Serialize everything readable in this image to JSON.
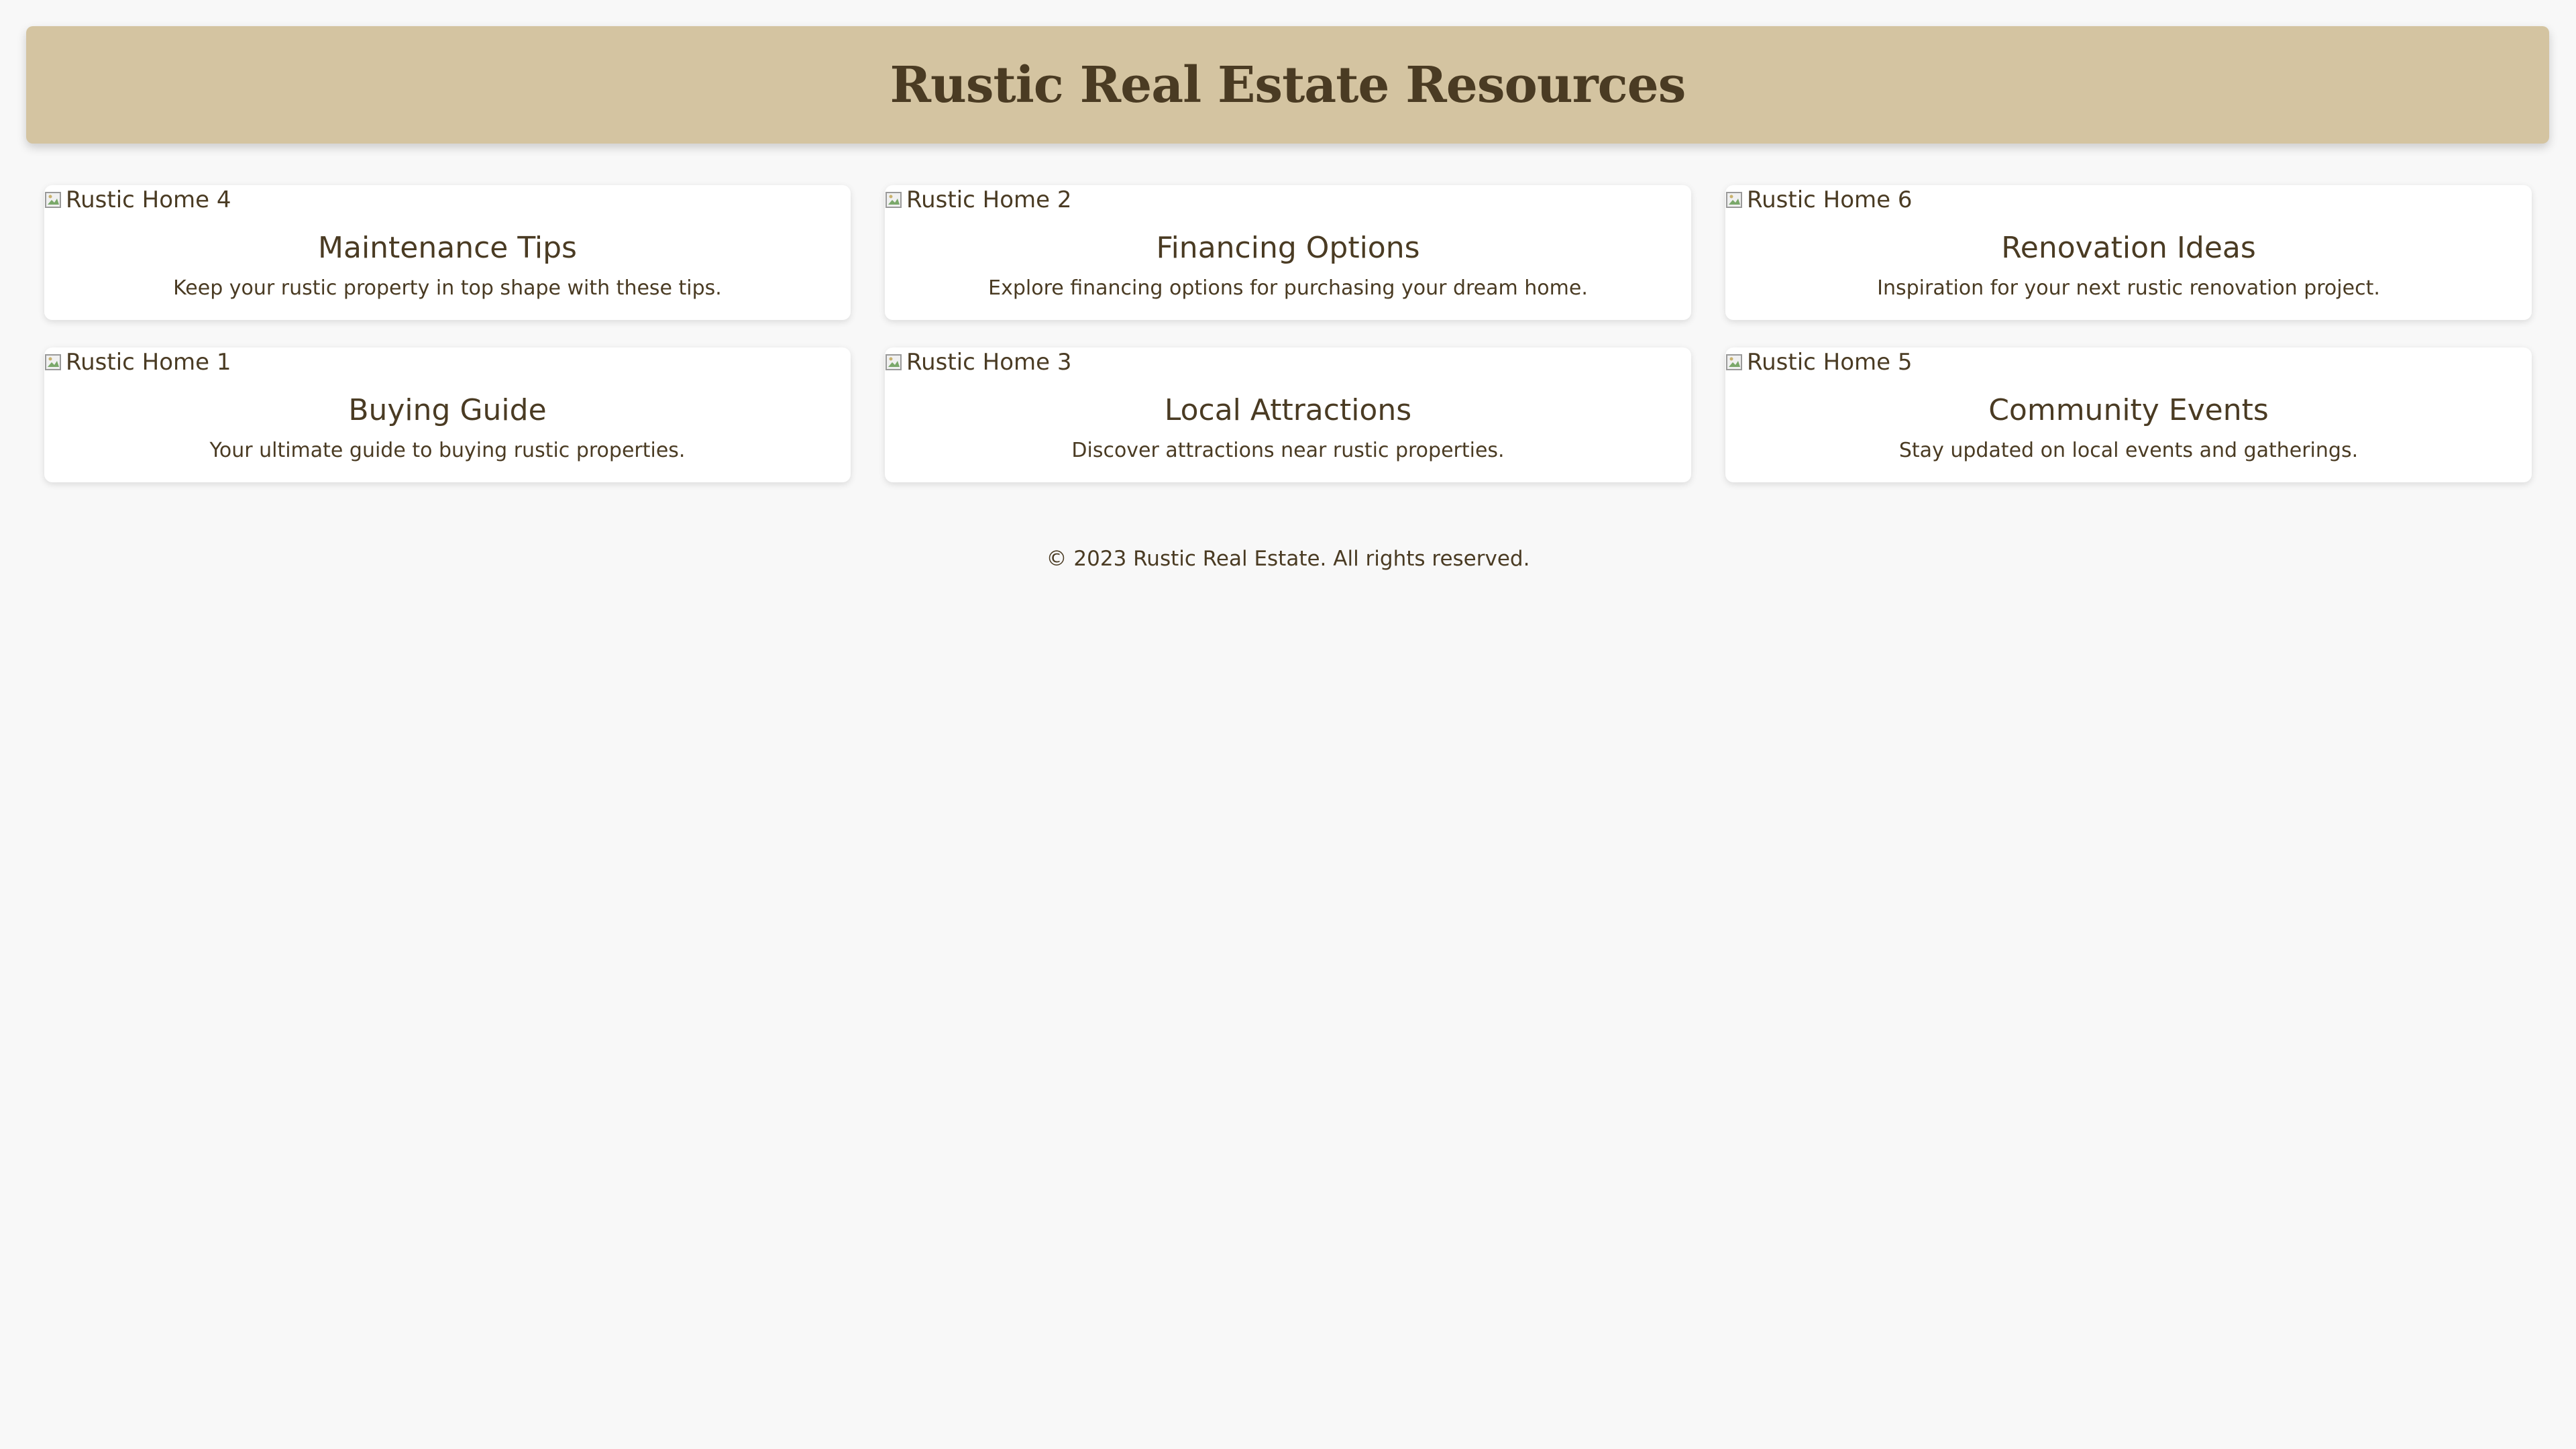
{
  "header": {
    "title": "Rustic Real Estate Resources"
  },
  "cards": [
    {
      "image_alt": "Rustic Home 4",
      "title": "Maintenance Tips",
      "description": "Keep your rustic property in top shape with these tips."
    },
    {
      "image_alt": "Rustic Home 2",
      "title": "Financing Options",
      "description": "Explore financing options for purchasing your dream home."
    },
    {
      "image_alt": "Rustic Home 6",
      "title": "Renovation Ideas",
      "description": "Inspiration for your next rustic renovation project."
    },
    {
      "image_alt": "Rustic Home 1",
      "title": "Buying Guide",
      "description": "Your ultimate guide to buying rustic properties."
    },
    {
      "image_alt": "Rustic Home 3",
      "title": "Local Attractions",
      "description": "Discover attractions near rustic properties."
    },
    {
      "image_alt": "Rustic Home 5",
      "title": "Community Events",
      "description": "Stay updated on local events and gatherings."
    }
  ],
  "footer": {
    "text": "© 2023 Rustic Real Estate. All rights reserved."
  },
  "colors": {
    "header_bg": "#d4c4a1",
    "text": "#4a3b23",
    "page_bg": "#f8f8f8",
    "card_bg": "#ffffff"
  },
  "icons": {
    "image_placeholder": "broken-image-icon"
  }
}
